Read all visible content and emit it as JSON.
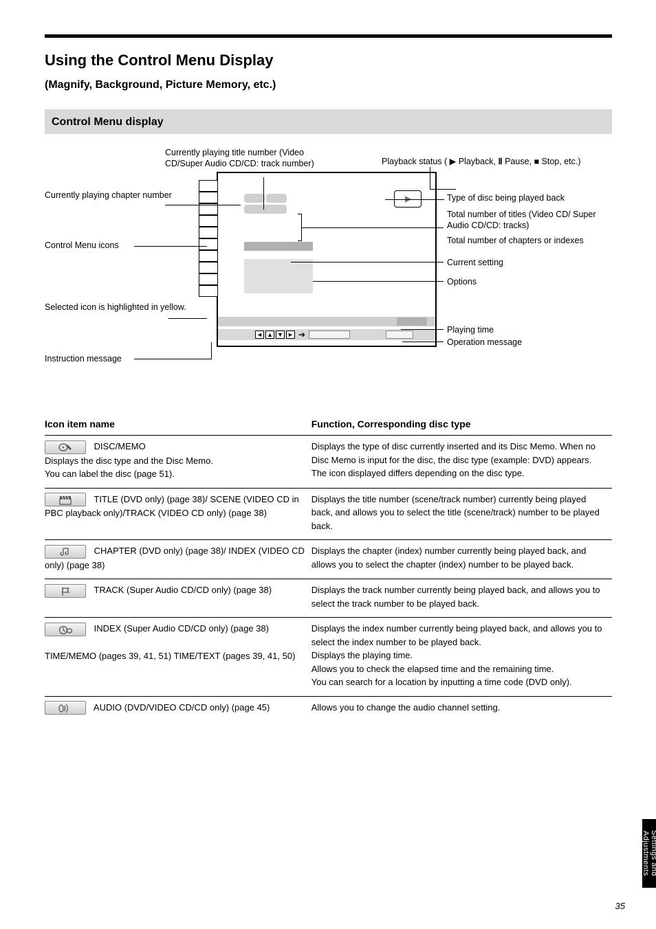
{
  "section_title": "Using the Control Menu Display",
  "sub_title": "(Magnify, Background, Picture Memory, etc.)",
  "gray_bar": "Control Menu display",
  "figure": {
    "top_label": "Currently playing title number (Video CD/Super Audio CD/CD: track number)",
    "top_right_labels": {
      "prefix_text": "Playback status (",
      "play_text": "Playback, ",
      "pause_text": "Pause, ",
      "stop_text": "Stop, etc.)"
    },
    "left_labels": {
      "chapter": "Currently playing chapter number",
      "icons": "Control Menu icons",
      "selected": "Selected icon is highlighted in yellow.",
      "instruction": "Instruction message"
    },
    "right_labels": {
      "disc_type": "Type of disc being played back",
      "total_titles": "Total number of titles (Video CD/ Super Audio CD/CD: tracks)",
      "total_chapters": "Total number of chapters or indexes",
      "setting": "Current setting",
      "options": "Options",
      "playing_time": "Playing time",
      "operation": "Operation message"
    }
  },
  "table": {
    "headers": [
      "Icon item name",
      "Function, Corresponding disc type"
    ],
    "rows": [
      {
        "icon": "disc-edit",
        "name": "DISC/MEMO",
        "desc_lines": [
          "Displays the disc type and the Disc Memo.",
          "You can label the disc (page 51)."
        ],
        "func": "Displays the type of disc currently inserted and its Disc Memo. When no Disc Memo is input for the disc, the disc type (example: DVD) appears. The icon displayed differs depending on the disc type."
      },
      {
        "icon": "clapper",
        "name": "TITLE (DVD only) (page 38)/ SCENE (VIDEO CD in PBC playback only)/TRACK (VIDEO CD only) (page 38)",
        "func": "Displays the title number (scene/track number) currently being played back, and allows you to select the title (scene/track) number to be played back."
      },
      {
        "icon": "music-note",
        "name": "CHAPTER (DVD only) (page 38)/ INDEX (VIDEO CD only) (page 38)",
        "func": "Displays the chapter (index) number currently being played back, and allows you to select the chapter (index) number to be played back."
      },
      {
        "icon": "flag",
        "name": "TRACK (Super Audio CD/CD only) (page 38)",
        "func": "Displays the track number currently being played back, and allows you to select the track number to be played back."
      },
      {
        "icon": "clock-disc",
        "name": "INDEX (Super Audio CD/CD only) (page 38)",
        "func_lines": [
          "Displays the index number currently being played back, and allows you to select the index number to be played back.",
          "Displays the playing time.",
          "Allows you to check the elapsed time and the remaining time.",
          "You can search for a location by inputting a time code (DVD only)."
        ],
        "extra_name": "TIME/MEMO (pages 39, 41, 51) TIME/TEXT (pages 39, 41, 50)"
      },
      {
        "icon": "audio-waves",
        "name": "AUDIO (DVD/VIDEO CD/CD only) (page 45)",
        "func": "Allows you to change the audio channel setting."
      }
    ]
  },
  "sidebar_tab": "Settings and Adjustments",
  "page_number": "35"
}
